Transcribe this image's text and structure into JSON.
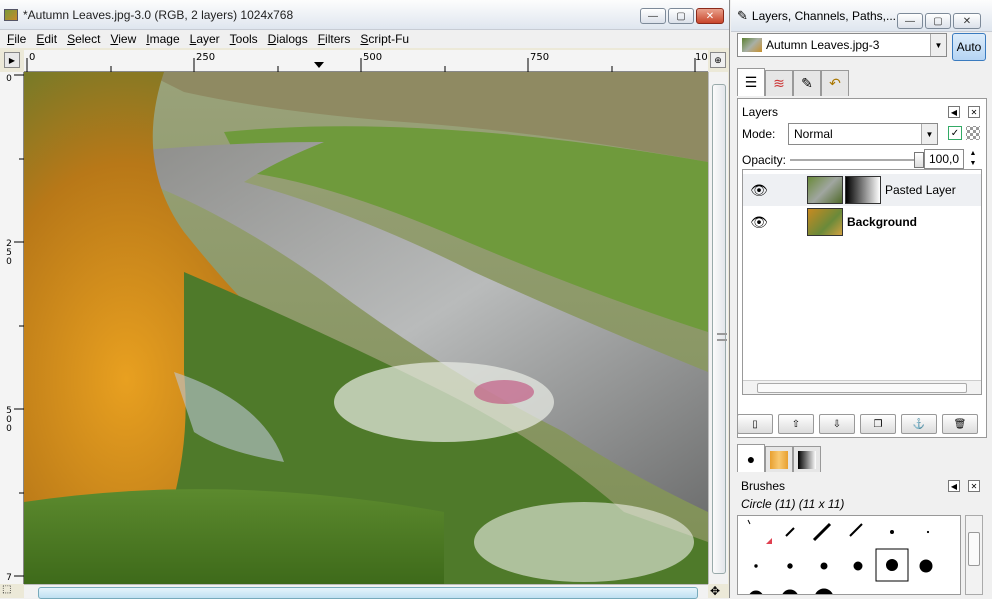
{
  "main_window": {
    "title": "*Autumn Leaves.jpg-3.0 (RGB, 2 layers) 1024x768",
    "minimize": "—",
    "maximize": "▢",
    "close": "✕"
  },
  "menu": [
    "File",
    "Edit",
    "Select",
    "View",
    "Image",
    "Layer",
    "Tools",
    "Dialogs",
    "Filters",
    "Script-Fu"
  ],
  "ruler_top": [
    "0",
    "250",
    "500",
    "750",
    "10"
  ],
  "ruler_left": [
    "0",
    "250",
    "500",
    "7"
  ],
  "dock": {
    "title": "Layers, Channels, Paths,...",
    "image_select": "Autumn Leaves.jpg-3",
    "auto_label": "Auto",
    "tab_icons": [
      "layers-icon",
      "channels-icon",
      "paths-icon",
      "undo-history-icon"
    ],
    "layers": {
      "title": "Layers",
      "mode_label": "Mode:",
      "mode_value": "Normal",
      "opacity_label": "Opacity:",
      "opacity_value": "100,0",
      "opacity_fraction": 1.0,
      "items": [
        {
          "name": "Pasted Layer",
          "visible": true,
          "bold": false
        },
        {
          "name": "Background",
          "visible": true,
          "bold": true
        }
      ]
    },
    "brushes": {
      "title": "Brushes",
      "current": "Circle (11) (11 x 11)"
    }
  }
}
